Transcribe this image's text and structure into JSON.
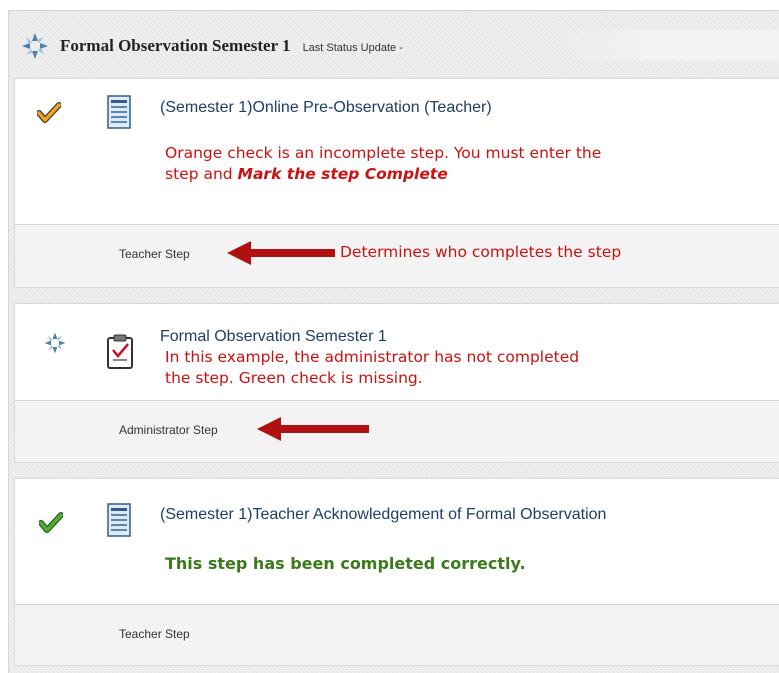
{
  "header": {
    "title": "Formal Observation Semester 1",
    "status": "Last Status Update -"
  },
  "steps": [
    {
      "title": "(Semester 1)Online Pre-Observation (Teacher)",
      "note_line1": "Orange check is an incomplete step. You must enter the",
      "note_line2_prefix": "step and ",
      "note_line2_emph": "Mark the step Complete",
      "footer": "Teacher Step",
      "annotation": "Determines who completes the step",
      "status_icon": "orange-check-icon",
      "doc_icon": "document-form-icon"
    },
    {
      "title": "Formal Observation Semester 1",
      "note_line1": "In this example, the administrator has not completed",
      "note_line2": "the step. Green check is missing.",
      "footer": "Administrator Step",
      "status_icon": "pending-spinner-icon",
      "doc_icon": "clipboard-check-icon"
    },
    {
      "title": "(Semester 1)Teacher Acknowledgement of Formal Observation",
      "note": "This step has been completed correctly.",
      "footer": "Teacher Step",
      "status_icon": "green-check-icon",
      "doc_icon": "document-form-icon"
    }
  ],
  "colors": {
    "annotation_red": "#cc1111",
    "arrow_red": "#b01010",
    "complete_green": "#3a7a1a",
    "incomplete_orange": "#f2a21b",
    "link_blue": "#1f3d66"
  }
}
